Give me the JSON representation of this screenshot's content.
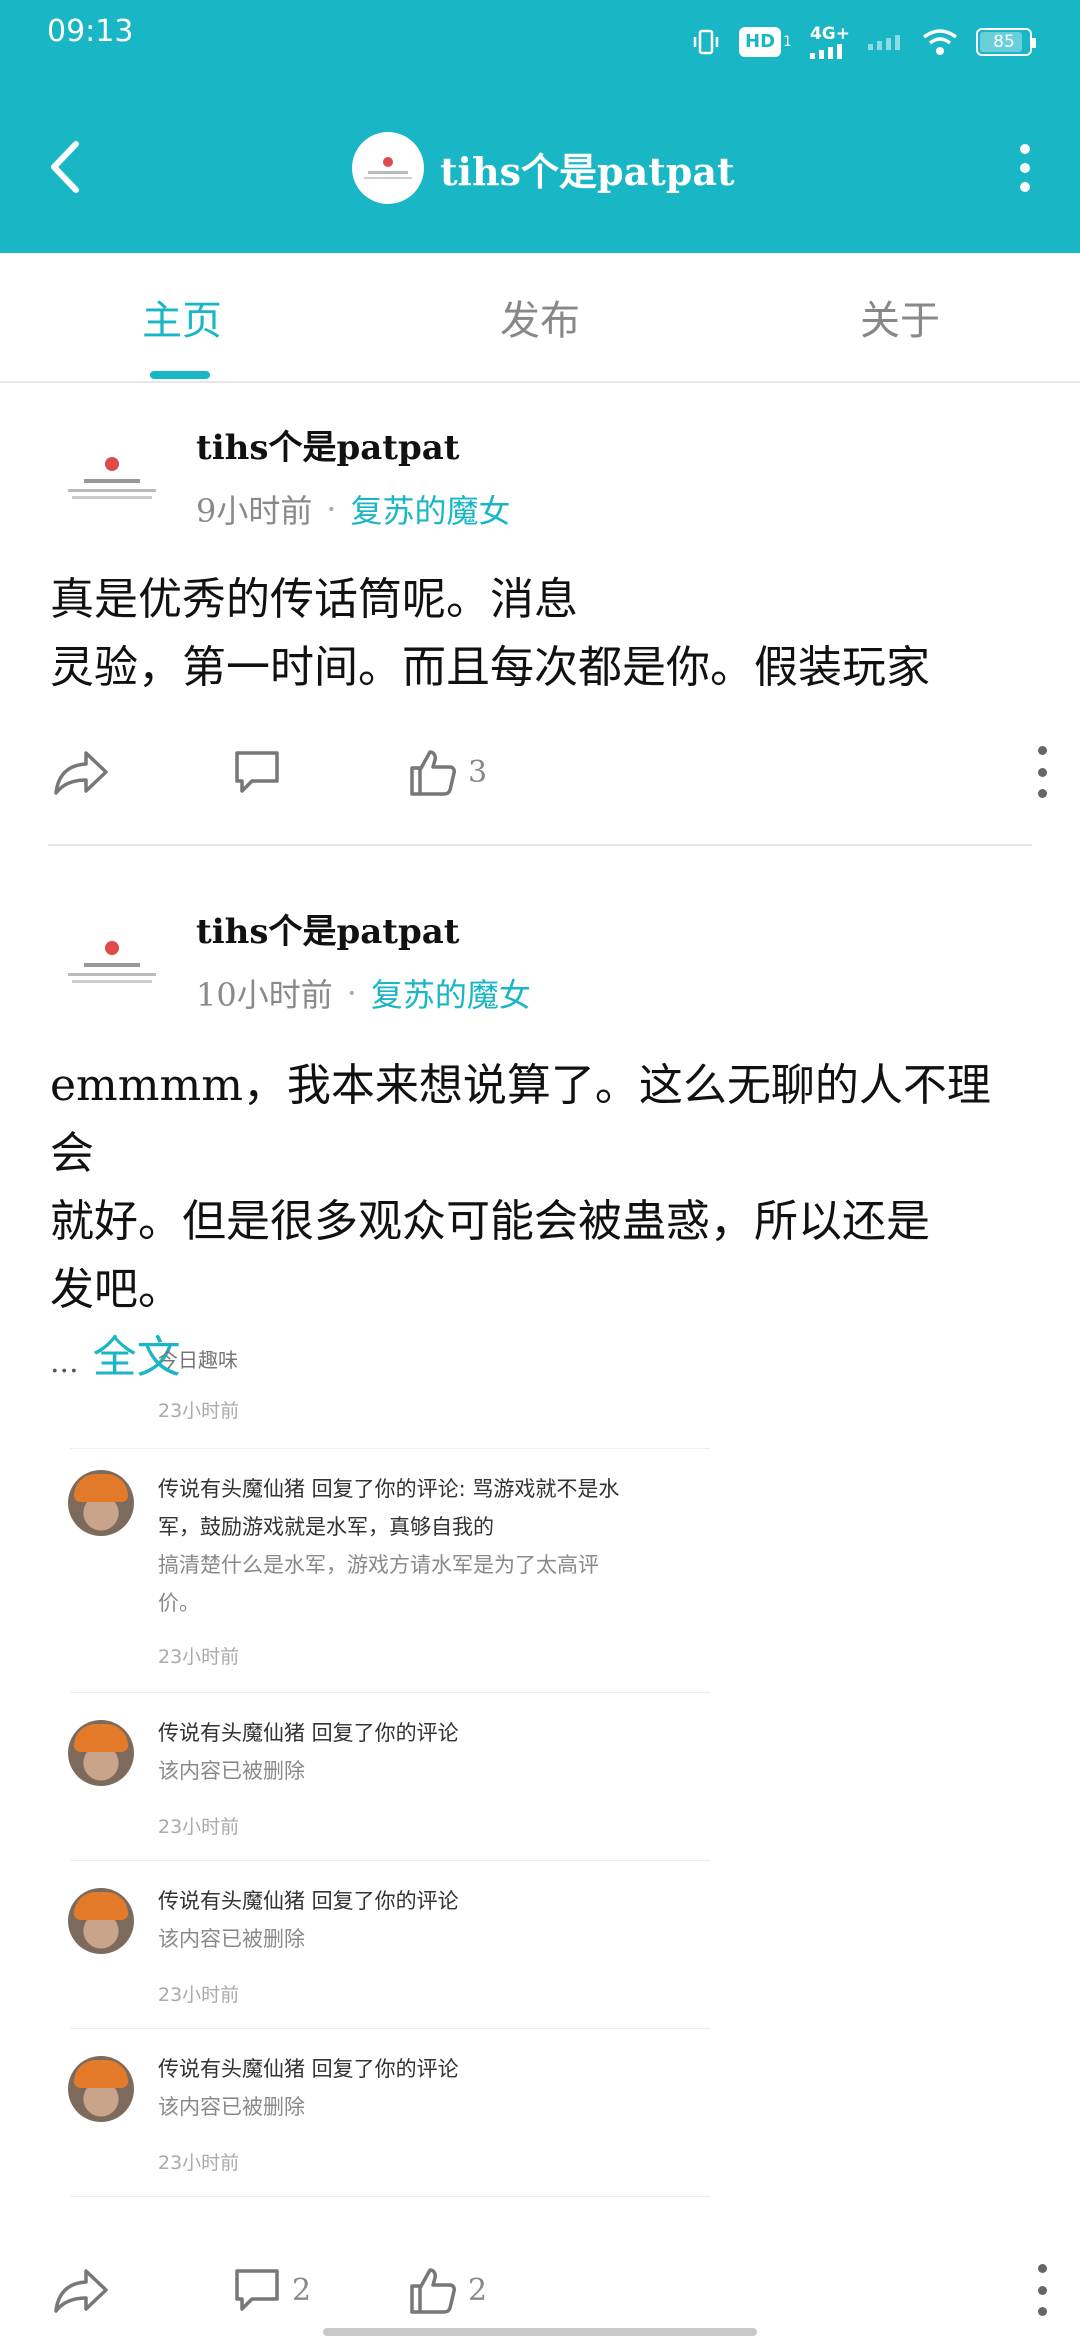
{
  "status_bar": {
    "time": "09:13",
    "hd_label": "HD",
    "hd_sub": "1",
    "network_label": "4G+",
    "battery_level": "85"
  },
  "header": {
    "title": "tihs个是patpat"
  },
  "tabs": [
    {
      "label": "主页",
      "active": true
    },
    {
      "label": "发布",
      "active": false
    },
    {
      "label": "关于",
      "active": false
    }
  ],
  "posts": [
    {
      "author": "tihs个是patpat",
      "time": "9小时前",
      "separator": "·",
      "circle": "复苏的魔女",
      "body_lines": [
        "真是优秀的传话筒呢。消息",
        "灵验，第一时间。而且每次都是你。假装玩家"
      ],
      "comments": "",
      "likes": "3"
    },
    {
      "author": "tihs个是patpat",
      "time": "10小时前",
      "separator": "·",
      "circle": "复苏的魔女",
      "body_lines": [
        "emmmm，我本来想说算了。这么无聊的人不理会",
        "就好。但是很多观众可能会被蛊惑，所以还是",
        "发吧。"
      ],
      "ellipsis": "...",
      "read_more": "全文",
      "comments": "2",
      "likes": "2",
      "embedded": {
        "top_text": "今日趣味",
        "top_time": "23小时前",
        "items": [
          {
            "title_line1": "传说有头魔仙猪 回复了你的评论: 骂游戏就不是水",
            "title_line2": "军，鼓励游戏就是水军，真够自我的",
            "sub_line1": "搞清楚什么是水军，游戏方请水军是为了太高评",
            "sub_line2": "价。",
            "time": "23小时前"
          },
          {
            "title_line1": "传说有头魔仙猪 回复了你的评论",
            "sub_line1": "该内容已被删除",
            "time": "23小时前"
          },
          {
            "title_line1": "传说有头魔仙猪 回复了你的评论",
            "sub_line1": "该内容已被删除",
            "time": "23小时前"
          },
          {
            "title_line1": "传说有头魔仙猪 回复了你的评论",
            "sub_line1": "该内容已被删除",
            "time": "23小时前"
          }
        ]
      }
    }
  ],
  "colors": {
    "accent": "#19b6c5",
    "text": "#111111",
    "muted": "#8a8a8a"
  }
}
